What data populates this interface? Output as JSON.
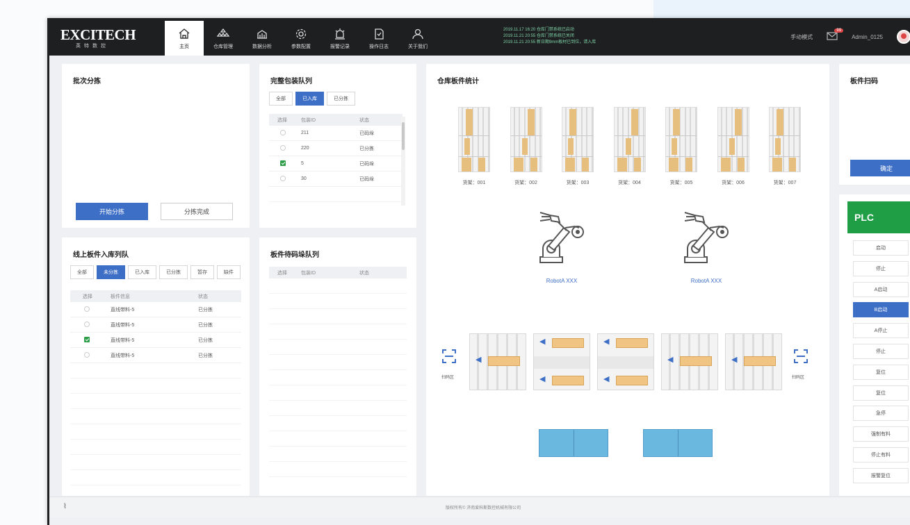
{
  "app": {
    "logo": "EXCITECH",
    "logo_sub": "英特数控"
  },
  "nav": [
    {
      "label": "主页",
      "icon": "home-icon",
      "active": true
    },
    {
      "label": "仓库管理",
      "icon": "boxes-icon"
    },
    {
      "label": "数据分析",
      "icon": "chart-building-icon"
    },
    {
      "label": "参数配置",
      "icon": "gear-icon"
    },
    {
      "label": "报警记录",
      "icon": "alarm-icon"
    },
    {
      "label": "操作日志",
      "icon": "document-icon"
    },
    {
      "label": "关于我们",
      "icon": "user-icon"
    }
  ],
  "notices": [
    "2019.11.17 16:20  仓库门禁系统已启动",
    "2019.11.21 20:55  仓库门禁系统已关闭",
    "2019.11.21 20:55  新日期9mm板材已到位，请入库"
  ],
  "topright": {
    "mode": "手动模式",
    "mail_count": "99",
    "user": "Admin_0125"
  },
  "batch": {
    "title": "批次分拣",
    "start_btn": "开始分拣",
    "done_btn": "分拣完成"
  },
  "pack_queue": {
    "title": "完整包装队列",
    "tabs": [
      "全部",
      "已入库",
      "已分拣"
    ],
    "active_tab": 1,
    "columns": [
      "选择",
      "包装ID",
      "状态"
    ],
    "rows": [
      {
        "id": "211",
        "status": "已码垛",
        "checked": false
      },
      {
        "id": "220",
        "status": "已分拣",
        "checked": false
      },
      {
        "id": "5",
        "status": "已码垛",
        "checked": true
      },
      {
        "id": "30",
        "status": "已码垛",
        "checked": false
      }
    ]
  },
  "online_queue": {
    "title": "线上板件入库列队",
    "tabs": [
      "全部",
      "未分拣",
      "已入库",
      "已分拣",
      "暂存",
      "缺件"
    ],
    "active_tab": 1,
    "columns": [
      "选择",
      "板件信息",
      "状态"
    ],
    "rows": [
      {
        "info": "直线带料-5",
        "status": "已分拣",
        "checked": false
      },
      {
        "info": "直线带料-5",
        "status": "已分拣",
        "checked": false
      },
      {
        "info": "直线带料-5",
        "status": "已分拣",
        "checked": true
      },
      {
        "info": "直线带料-5",
        "status": "已分拣",
        "checked": false
      }
    ]
  },
  "board_queue": {
    "title": "板件待码垛队列",
    "columns": [
      "选择",
      "包装ID",
      "状态"
    ]
  },
  "warehouse": {
    "title": "仓库板件统计",
    "racks": [
      "货架：001",
      "货架：002",
      "货架：003",
      "货架：004",
      "货架：005",
      "货架：006",
      "货架：007"
    ],
    "robots": [
      "RobotA  XXX",
      "RobotA  XXX"
    ],
    "scan_labels": [
      "扫码区",
      "扫码区"
    ]
  },
  "scan_panel": {
    "title": "板件扫码",
    "confirm_btn": "确定"
  },
  "plc": {
    "title": "PLC",
    "buttons": [
      "启动",
      "停止",
      "A启动",
      "B启动",
      "A停止",
      "停止",
      "复位",
      "复位",
      "急停",
      "强制有料",
      "停止有料",
      "报警复位"
    ],
    "active_index": 3
  },
  "footer": {
    "text": "版权所有© 济南爱科斯数控机械有限公司"
  },
  "colors": {
    "accent": "#3e6fc6",
    "topbar": "#1e1f21",
    "plc_green": "#1f9e45",
    "goods": "#e6bf7f",
    "notice": "#7fd4a8"
  }
}
